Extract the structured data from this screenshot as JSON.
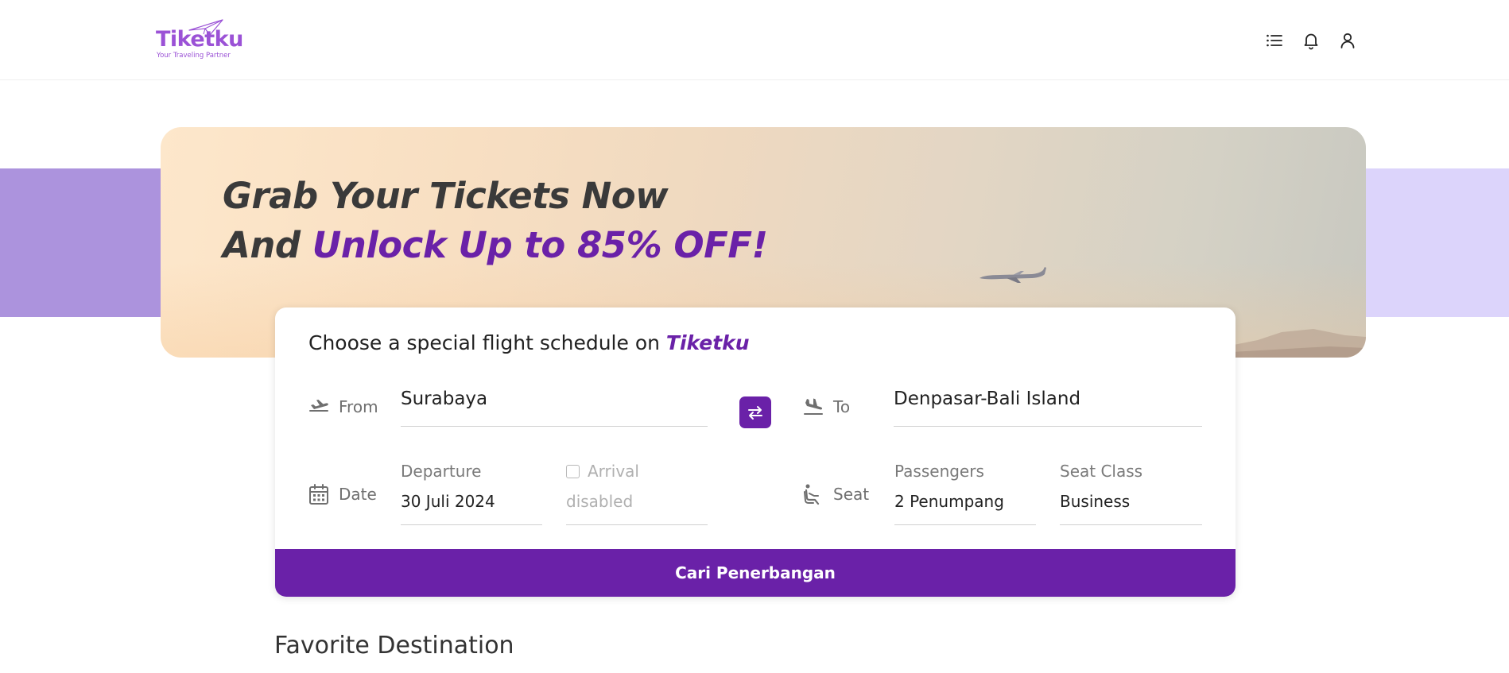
{
  "header": {
    "logo_text": "Tiketku",
    "logo_tagline": "Your Traveling Partner",
    "icons": [
      "list-icon",
      "bell-icon",
      "user-icon"
    ]
  },
  "hero": {
    "line1": "Grab Your Tickets Now",
    "line2_prefix": "And ",
    "line2_accent": "Unlock Up to 85% OFF!"
  },
  "search": {
    "title_prefix": "Choose a special flight schedule on ",
    "title_brand": "Tiketku",
    "from_label": "From",
    "from_value": "Surabaya",
    "to_label": "To",
    "to_value": "Denpasar-Bali Island",
    "date_label": "Date",
    "departure_label": "Departure",
    "departure_value": "30 Juli 2024",
    "arrival_label": "Arrival",
    "arrival_value": "disabled",
    "seat_label": "Seat",
    "passengers_label": "Passengers",
    "passengers_value": "2 Penumpang",
    "seat_class_label": "Seat Class",
    "seat_class_value": "Business",
    "button_label": "Cari Penerbangan"
  },
  "favorite": {
    "title": "Favorite Destination"
  },
  "colors": {
    "primary": "#6a21a8",
    "logo": "#9b52d6",
    "band_left": "#ac93dd",
    "band_right": "#dcd4fb"
  }
}
